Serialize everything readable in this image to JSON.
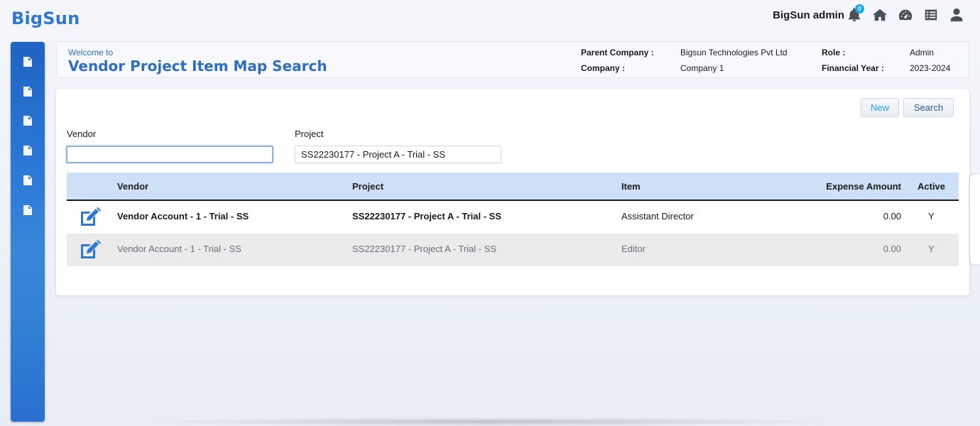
{
  "app": {
    "logo": "BigSun",
    "user_name": "BigSun admin",
    "notification_count": "0",
    "icons": [
      "bell-icon",
      "home-icon",
      "dashboard-icon",
      "list-icon",
      "user-icon"
    ]
  },
  "sidebar": {
    "items": [
      {
        "icon": "document-icon"
      },
      {
        "icon": "document-icon"
      },
      {
        "icon": "document-icon"
      },
      {
        "icon": "document-icon"
      },
      {
        "icon": "document-icon"
      },
      {
        "icon": "document-icon"
      }
    ]
  },
  "header": {
    "welcome": "Welcome to",
    "title": "Vendor Project Item Map Search",
    "parent_company_label": "Parent Company :",
    "parent_company_value": "Bigsun Technologies Pvt Ltd",
    "company_label": "Company :",
    "company_value": "Company 1",
    "role_label": "Role :",
    "role_value": "Admin",
    "financial_year_label": "Financial Year :",
    "financial_year_value": "2023-2024"
  },
  "actions": {
    "new_label": "New",
    "search_label": "Search"
  },
  "filters": {
    "vendor_label": "Vendor",
    "vendor_value": "",
    "project_label": "Project",
    "project_value": "SS22230177 - Project A - Trial - SS"
  },
  "table": {
    "columns": [
      "Vendor",
      "Project",
      "Item",
      "Expense Amount",
      "Active"
    ],
    "rows": [
      {
        "vendor": "Vendor Account - 1 - Trial - SS",
        "project": "SS22230177 - Project A - Trial - SS",
        "item": "Assistant Director",
        "expense_amount": "0.00",
        "active": "Y"
      },
      {
        "vendor": "Vendor Account - 1 - Trial - SS",
        "project": "SS22230177 - Project A - Trial - SS",
        "item": "Editor",
        "expense_amount": "0.00",
        "active": "Y"
      }
    ]
  },
  "colors": {
    "brand": "#2f78cf",
    "sidebar": "#2c7ad8",
    "table_header": "#cfe1f8",
    "badge": "#1aa8e8"
  }
}
